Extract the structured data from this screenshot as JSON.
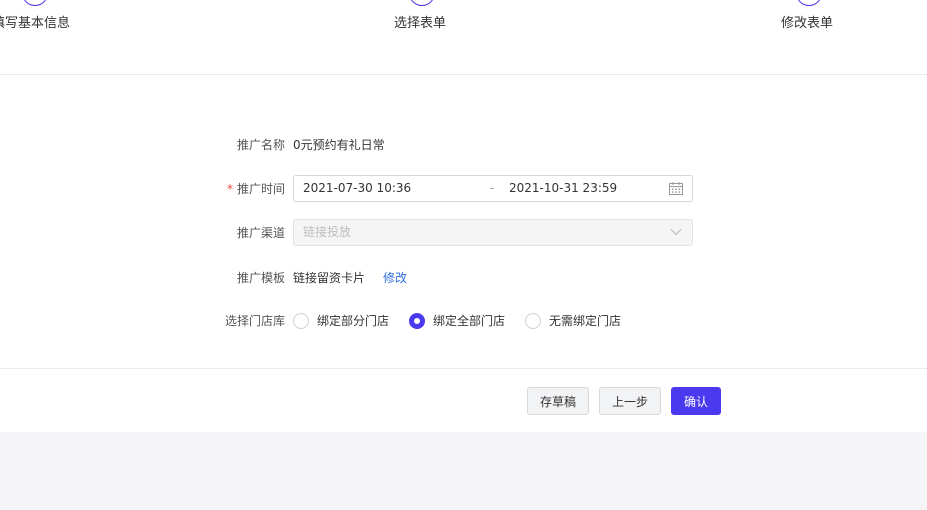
{
  "steps": [
    {
      "label": "填写基本信息"
    },
    {
      "label": "选择表单"
    },
    {
      "label": "修改表单"
    }
  ],
  "form": {
    "name": {
      "label": "推广名称",
      "value": "0元预约有礼日常"
    },
    "time": {
      "label": "推广时间",
      "required_mark": "*",
      "start": "2021-07-30 10:36",
      "separator": "-",
      "end": "2021-10-31 23:59"
    },
    "channel": {
      "label": "推广渠道",
      "value": "链接投放"
    },
    "template": {
      "label": "推广模板",
      "value": "链接留资卡片",
      "action": "修改"
    },
    "store": {
      "label": "选择门店库",
      "options": [
        {
          "label": "绑定部分门店",
          "checked": false
        },
        {
          "label": "绑定全部门店",
          "checked": true
        },
        {
          "label": "无需绑定门店",
          "checked": false
        }
      ]
    }
  },
  "footer": {
    "draft_label": "存草稿",
    "prev_label": "上一步",
    "confirm_label": "确认"
  },
  "colors": {
    "accent": "#4b39ef",
    "link": "#2f6fe0",
    "required": "#f04b3a"
  },
  "icons": {
    "date": "calendar-icon",
    "select": "chevron-down-icon"
  }
}
